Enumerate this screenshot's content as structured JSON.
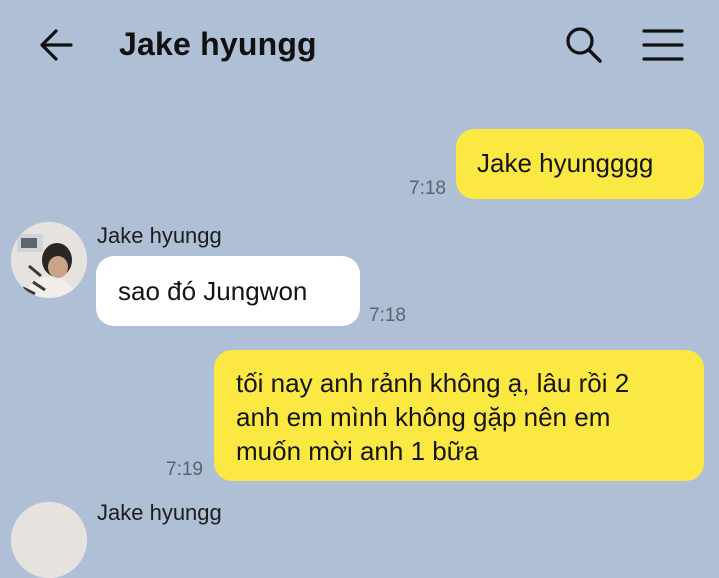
{
  "header": {
    "title": "Jake hyungg",
    "back_icon": "arrow-left-icon",
    "search_icon": "search-icon",
    "menu_icon": "menu-icon"
  },
  "colors": {
    "background": "#aebfd6",
    "my_bubble": "#fbe842",
    "other_bubble": "#ffffff"
  },
  "messages": [
    {
      "from": "me",
      "text": "Jake hyungggg",
      "time": "7:18"
    },
    {
      "from": "other",
      "sender": "Jake hyungg",
      "text": "sao đó Jungwon",
      "time": "7:18"
    },
    {
      "from": "me",
      "lines": [
        "tối nay anh rảnh không ạ, lâu rồi 2",
        "anh em mình không gặp nên em",
        "muốn mời anh 1 bữa"
      ],
      "time": "7:19"
    },
    {
      "from": "other",
      "sender": "Jake hyungg"
    }
  ]
}
